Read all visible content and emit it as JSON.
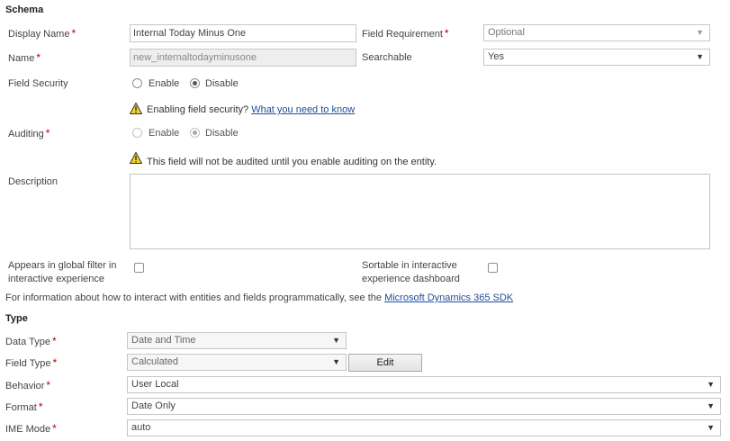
{
  "schema": {
    "title": "Schema",
    "display_name": {
      "label": "Display Name",
      "required": "*",
      "value": "Internal Today Minus One"
    },
    "field_requirement": {
      "label": "Field Requirement",
      "required": "*",
      "value": "Optional"
    },
    "name": {
      "label": "Name",
      "required": "*",
      "value": "new_internaltodayminusone"
    },
    "searchable": {
      "label": "Searchable",
      "value": "Yes"
    },
    "field_security": {
      "label": "Field Security",
      "enable": "Enable",
      "disable": "Disable",
      "selected": "Disable"
    },
    "field_security_warning": {
      "text": "Enabling field security?",
      "link": "What you need to know"
    },
    "auditing": {
      "label": "Auditing",
      "required": "*",
      "enable": "Enable",
      "disable": "Disable",
      "selected": "Disable"
    },
    "auditing_warning": {
      "text": "This field will not be audited until you enable auditing on the entity."
    },
    "description": {
      "label": "Description",
      "value": ""
    },
    "global_filter": {
      "label_line1": "Appears in global filter in",
      "label_line2": "interactive experience",
      "checked": false
    },
    "sortable": {
      "label_line1": "Sortable in interactive",
      "label_line2": "experience dashboard",
      "checked": false
    },
    "sdk_info": {
      "text": "For information about how to interact with entities and fields programmatically, see the",
      "link": "Microsoft Dynamics 365 SDK"
    }
  },
  "type": {
    "title": "Type",
    "data_type": {
      "label": "Data Type",
      "required": "*",
      "value": "Date and Time"
    },
    "field_type": {
      "label": "Field Type",
      "required": "*",
      "value": "Calculated",
      "button": "Edit"
    },
    "behavior": {
      "label": "Behavior",
      "required": "*",
      "value": "User Local"
    },
    "format": {
      "label": "Format",
      "required": "*",
      "value": "Date Only"
    },
    "ime_mode": {
      "label": "IME Mode",
      "required": "*",
      "value": "auto"
    }
  },
  "icons": {
    "warning": "warning-icon",
    "dropdown": "chevron-down-icon"
  },
  "colors": {
    "required": "#c00000",
    "link": "#1f4e99",
    "warning_fill": "#f5d327"
  }
}
